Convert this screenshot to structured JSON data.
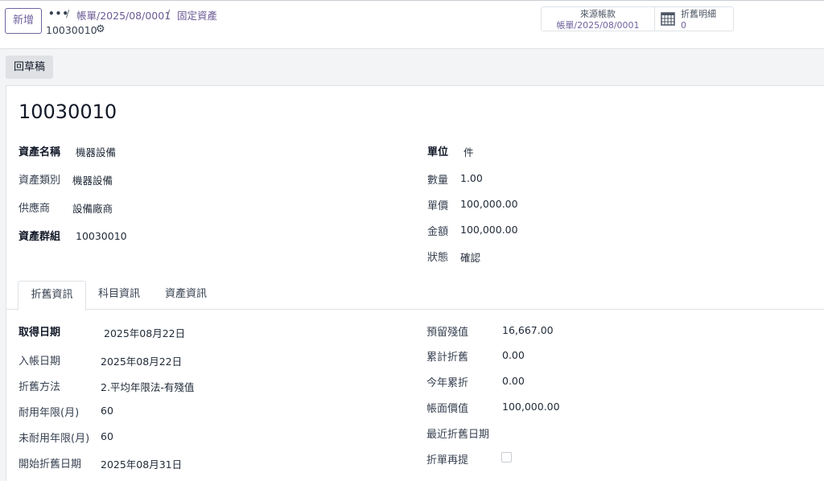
{
  "header": {
    "new_button": "新增",
    "more_dots": "•••",
    "breadcrumb": [
      "帳單/2025/08/0001",
      "固定資產"
    ],
    "separator": "/",
    "record_id": "10030010",
    "gear_icon": "gear-icon"
  },
  "smart_buttons": {
    "source": {
      "label": "來源帳款",
      "value": "帳單/2025/08/0001"
    },
    "depreciation": {
      "label": "折舊明細",
      "value": "0",
      "icon": "calendar-grid-icon"
    }
  },
  "status_bar": {
    "draft_button": "回草稿"
  },
  "form": {
    "title": "10030010",
    "left_fields": [
      {
        "label": "資產名稱",
        "value": "機器設備"
      },
      {
        "label": "資產類別",
        "value": "機器設備"
      },
      {
        "label": "供應商",
        "value": "設備廠商"
      },
      {
        "label": "資產群組",
        "value": "10030010"
      }
    ],
    "right_fields": [
      {
        "label": "單位",
        "value": "件"
      },
      {
        "label": "數量",
        "value": "1.00"
      },
      {
        "label": "單價",
        "value": "100,000.00"
      },
      {
        "label": "金額",
        "value": "100,000.00"
      },
      {
        "label": "狀態",
        "value": "確認"
      }
    ]
  },
  "tabs": [
    "折舊資訊",
    "科目資訊",
    "資產資訊"
  ],
  "depreciation_tab": {
    "left_fields": [
      {
        "label": "取得日期",
        "value": "2025年08月22日"
      },
      {
        "label": "入帳日期",
        "value": "2025年08月22日"
      },
      {
        "label": "折舊方法",
        "value": "2.平均年限法-有殘值"
      },
      {
        "label": "耐用年限(月)",
        "value": "60"
      },
      {
        "label": "未耐用年限(月)",
        "value": "60"
      },
      {
        "label": "開始折舊日期",
        "value": "2025年08月31日"
      }
    ],
    "right_fields": [
      {
        "label": "預留殘值",
        "value": "16,667.00"
      },
      {
        "label": "累計折舊",
        "value": "0.00"
      },
      {
        "label": "今年累折",
        "value": "0.00"
      },
      {
        "label": "帳面價值",
        "value": "100,000.00"
      },
      {
        "label": "最近折舊日期",
        "value": ""
      },
      {
        "label": "折單再提",
        "value": ""
      }
    ]
  }
}
